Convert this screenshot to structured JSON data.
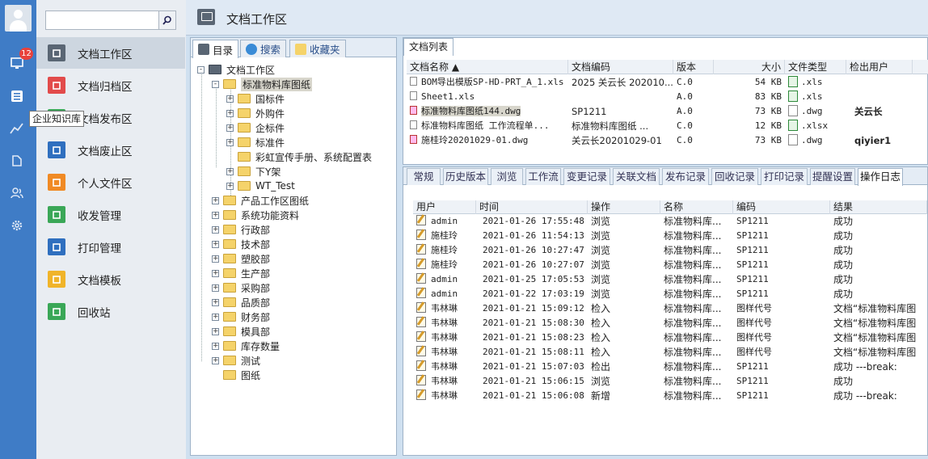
{
  "rail": {
    "badge_count": "12",
    "tooltip": "企业知识库",
    "icons": [
      "avatar-icon",
      "monitor-icon",
      "list-icon",
      "chart-icon",
      "knowledge-icon",
      "users-icon",
      "gear-icon"
    ]
  },
  "search": {
    "placeholder": "",
    "value": ""
  },
  "nav": {
    "items": [
      {
        "label": "文档工作区",
        "color": "#5a6674",
        "icon": "monitor-icon"
      },
      {
        "label": "文档归档区",
        "color": "#e24b4b",
        "icon": "archive-icon"
      },
      {
        "label": "文档发布区",
        "color": "#3aa757",
        "icon": "publish-icon"
      },
      {
        "label": "文档废止区",
        "color": "#2f6fbf",
        "icon": "abolish-icon"
      },
      {
        "label": "个人文件区",
        "color": "#f08a24",
        "icon": "personal-icon"
      },
      {
        "label": "收发管理",
        "color": "#3aa757",
        "icon": "sendreceive-icon"
      },
      {
        "label": "打印管理",
        "color": "#2f6fbf",
        "icon": "printer-icon"
      },
      {
        "label": "文档模板",
        "color": "#f0b429",
        "icon": "template-icon"
      },
      {
        "label": "回收站",
        "color": "#3aa757",
        "icon": "trash-icon"
      }
    ]
  },
  "header": {
    "title": "文档工作区"
  },
  "tree_tabs": [
    "目录",
    "搜索",
    "收藏夹"
  ],
  "tree": [
    {
      "label": "文档工作区"
    },
    {
      "label": "标准物料库图纸"
    },
    {
      "label": "国标件"
    },
    {
      "label": "外购件"
    },
    {
      "label": "企标件"
    },
    {
      "label": "标准件"
    },
    {
      "label": "彩虹宣传手册、系统配置表"
    },
    {
      "label": "下Y架"
    },
    {
      "label": "WT_Test"
    },
    {
      "label": "产品工作区图纸"
    },
    {
      "label": "系统功能资料"
    },
    {
      "label": "行政部"
    },
    {
      "label": "技术部"
    },
    {
      "label": "塑胶部"
    },
    {
      "label": "生产部"
    },
    {
      "label": "采购部"
    },
    {
      "label": "品质部"
    },
    {
      "label": "财务部"
    },
    {
      "label": "模具部"
    },
    {
      "label": "库存数量"
    },
    {
      "label": "测试"
    },
    {
      "label": "图纸"
    }
  ],
  "doc_list": {
    "tab": "文档列表",
    "columns": [
      "文档名称 ▲",
      "文档编码",
      "版本",
      "大小",
      "文件类型",
      "检出用户",
      ""
    ],
    "rows": [
      {
        "name": "BOM导出模版SP-HD-PRT_A_1.xls",
        "code": "2025 关云长 202010...",
        "version": "C.0",
        "size": "54 KB",
        "type": ".xls",
        "checkout": ""
      },
      {
        "name": "Sheet1.xls",
        "code": "",
        "version": "A.0",
        "size": "83 KB",
        "type": ".xls",
        "checkout": ""
      },
      {
        "name": "标准物料库图纸144.dwg",
        "code": "SP1211",
        "version": "A.0",
        "size": "73 KB",
        "type": ".dwg",
        "checkout": "关云长"
      },
      {
        "name": "标准物料库图纸 工作流程单...",
        "code": "标准物料库图纸 ...",
        "version": "C.0",
        "size": "12 KB",
        "type": ".xlsx",
        "checkout": ""
      },
      {
        "name": "施桂玲20201029-01.dwg",
        "code": "关云长20201029-01",
        "version": "C.0",
        "size": "73 KB",
        "type": ".dwg",
        "checkout": "qiyier1"
      }
    ]
  },
  "detail_tabs": [
    "常规",
    "历史版本",
    "浏览",
    "工作流",
    "变更记录",
    "关联文档",
    "发布记录",
    "回收记录",
    "打印记录",
    "提醒设置",
    "操作日志"
  ],
  "log": {
    "columns": [
      "用户",
      "时间",
      "操作",
      "名称",
      "编码",
      "结果"
    ],
    "rows": [
      {
        "user": "admin",
        "time": "2021-01-26 17:55:48",
        "op": "浏览",
        "name": "标准物料库...",
        "code": "SP1211",
        "result": "成功"
      },
      {
        "user": "施桂玲",
        "time": "2021-01-26 11:54:13",
        "op": "浏览",
        "name": "标准物料库...",
        "code": "SP1211",
        "result": "成功"
      },
      {
        "user": "施桂玲",
        "time": "2021-01-26 10:27:47",
        "op": "浏览",
        "name": "标准物料库...",
        "code": "SP1211",
        "result": "成功"
      },
      {
        "user": "施桂玲",
        "time": "2021-01-26 10:27:07",
        "op": "浏览",
        "name": "标准物料库...",
        "code": "SP1211",
        "result": "成功"
      },
      {
        "user": "admin",
        "time": "2021-01-25 17:05:53",
        "op": "浏览",
        "name": "标准物料库...",
        "code": "SP1211",
        "result": "成功"
      },
      {
        "user": "admin",
        "time": "2021-01-22 17:03:19",
        "op": "浏览",
        "name": "标准物料库...",
        "code": "SP1211",
        "result": "成功"
      },
      {
        "user": "韦林琳",
        "time": "2021-01-21 15:09:12",
        "op": "检入",
        "name": "标准物料库...",
        "code": "图样代号",
        "result": "文档“标准物料库图"
      },
      {
        "user": "韦林琳",
        "time": "2021-01-21 15:08:30",
        "op": "检入",
        "name": "标准物料库...",
        "code": "图样代号",
        "result": "文档“标准物料库图"
      },
      {
        "user": "韦林琳",
        "time": "2021-01-21 15:08:23",
        "op": "检入",
        "name": "标准物料库...",
        "code": "图样代号",
        "result": "文档“标准物料库图"
      },
      {
        "user": "韦林琳",
        "time": "2021-01-21 15:08:11",
        "op": "检入",
        "name": "标准物料库...",
        "code": "图样代号",
        "result": "文档“标准物料库图"
      },
      {
        "user": "韦林琳",
        "time": "2021-01-21 15:07:03",
        "op": "检出",
        "name": "标准物料库...",
        "code": "SP1211",
        "result": "成功 ---break:"
      },
      {
        "user": "韦林琳",
        "time": "2021-01-21 15:06:15",
        "op": "浏览",
        "name": "标准物料库...",
        "code": "SP1211",
        "result": "成功"
      },
      {
        "user": "韦林琳",
        "time": "2021-01-21 15:06:08",
        "op": "新增",
        "name": "标准物料库...",
        "code": "SP1211",
        "result": "成功 ---break:"
      }
    ]
  }
}
